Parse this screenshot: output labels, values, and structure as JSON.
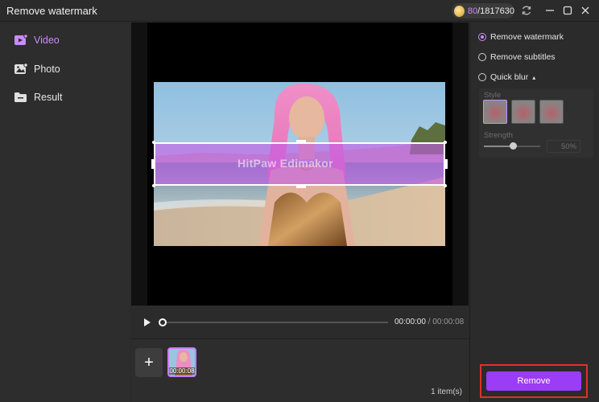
{
  "window": {
    "title": "Remove watermark"
  },
  "credits": {
    "used": "80",
    "total": "/1817630"
  },
  "sidebar": {
    "items": [
      {
        "label": "Video",
        "icon": "video-icon",
        "active": true
      },
      {
        "label": "Photo",
        "icon": "photo-icon",
        "active": false
      },
      {
        "label": "Result",
        "icon": "folder-icon",
        "active": false
      }
    ]
  },
  "preview": {
    "watermark_text": "HitPaw Edimakor"
  },
  "player": {
    "current_time": "00:00:00",
    "separator": " / ",
    "duration": "00:00:08",
    "progress": 0
  },
  "media": {
    "add_label": "+",
    "thumb_duration": "00:00:08",
    "count": "1 item(s)"
  },
  "panel": {
    "options": [
      {
        "label": "Remove watermark",
        "selected": true
      },
      {
        "label": "Remove subtitles",
        "selected": false
      },
      {
        "label": "Quick blur",
        "selected": false,
        "caret": "▴"
      }
    ],
    "style_label": "Style",
    "strength_label": "Strength",
    "strength_value": "50%",
    "strength": 0.5,
    "remove_label": "Remove"
  },
  "colors": {
    "accent": "#c98cff",
    "button": "#9b3cf6",
    "highlight_border": "#e0302a",
    "selection": "#c45ae6"
  }
}
